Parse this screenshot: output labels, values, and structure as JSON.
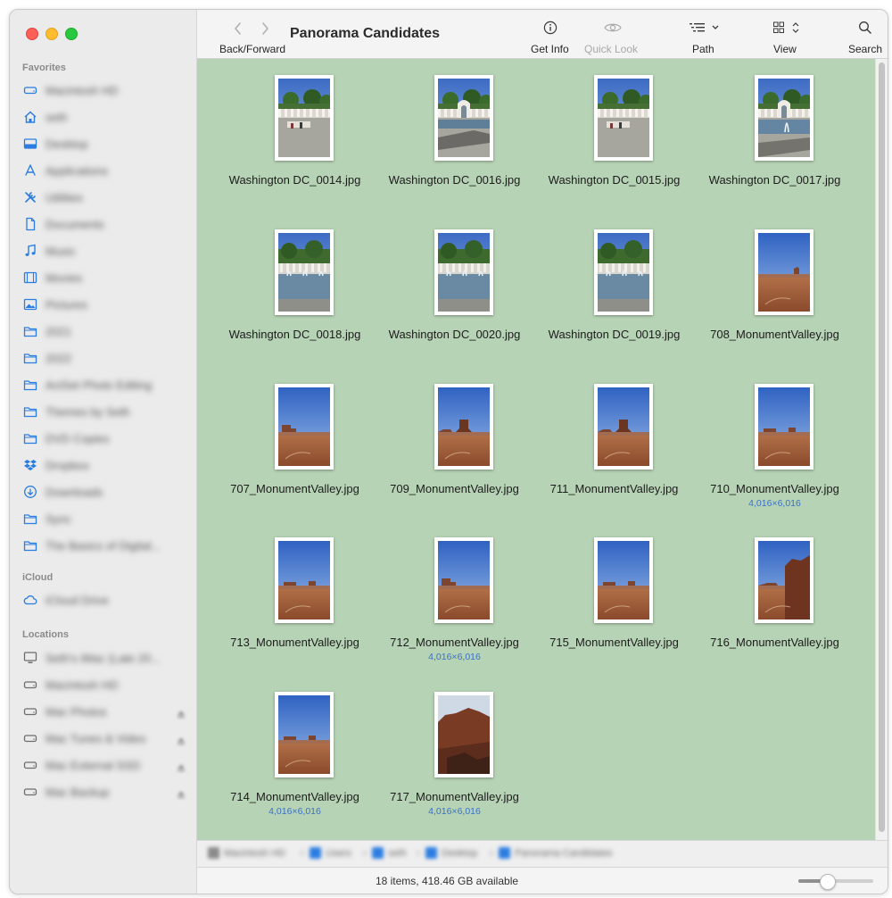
{
  "window": {
    "title": "Panorama Candidates"
  },
  "toolbar": {
    "back_forward_label": "Back/Forward",
    "get_info_label": "Get Info",
    "quick_look_label": "Quick Look",
    "path_label": "Path",
    "view_label": "View",
    "search_label": "Search"
  },
  "sidebar": {
    "favorites_heading": "Favorites",
    "favorites": [
      {
        "label": "Macintosh HD",
        "icon": "drive-icon"
      },
      {
        "label": "seth",
        "icon": "home-icon"
      },
      {
        "label": "Desktop",
        "icon": "desktop-icon"
      },
      {
        "label": "Applications",
        "icon": "applications-icon"
      },
      {
        "label": "Utilities",
        "icon": "utilities-icon"
      },
      {
        "label": "Documents",
        "icon": "document-icon"
      },
      {
        "label": "Music",
        "icon": "music-icon"
      },
      {
        "label": "Movies",
        "icon": "movies-icon"
      },
      {
        "label": "Pictures",
        "icon": "pictures-icon"
      },
      {
        "label": "2021",
        "icon": "folder-icon"
      },
      {
        "label": "2022",
        "icon": "folder-icon"
      },
      {
        "label": "ActSet Photo Editing",
        "icon": "folder-icon"
      },
      {
        "label": "Themes by Seth",
        "icon": "folder-icon"
      },
      {
        "label": "DVD Copies",
        "icon": "folder-icon"
      },
      {
        "label": "Dropbox",
        "icon": "dropbox-icon"
      },
      {
        "label": "Downloads",
        "icon": "downloads-icon"
      },
      {
        "label": "Sync",
        "icon": "folder-icon"
      },
      {
        "label": "The Basics of Digital...",
        "icon": "folder-icon"
      }
    ],
    "icloud_heading": "iCloud",
    "icloud": [
      {
        "label": "iCloud Drive",
        "icon": "cloud-icon"
      }
    ],
    "locations_heading": "Locations",
    "locations": [
      {
        "label": "Seth's iMac (Late 20...",
        "icon": "computer-icon",
        "eject": false
      },
      {
        "label": "Macintosh HD",
        "icon": "drive-icon",
        "eject": false
      },
      {
        "label": "Mac Photos",
        "icon": "drive-icon",
        "eject": true
      },
      {
        "label": "Mac Tunes & Video",
        "icon": "drive-icon",
        "eject": true
      },
      {
        "label": "Mac External SSD",
        "icon": "drive-icon",
        "eject": true
      },
      {
        "label": "Mac Backup",
        "icon": "drive-icon",
        "eject": true
      }
    ]
  },
  "files": [
    {
      "name": "Washington DC_0014.jpg",
      "dims": "",
      "scene": "dc-a"
    },
    {
      "name": "Washington DC_0016.jpg",
      "dims": "",
      "scene": "dc-b"
    },
    {
      "name": "Washington DC_0015.jpg",
      "dims": "",
      "scene": "dc-a"
    },
    {
      "name": "Washington DC_0017.jpg",
      "dims": "",
      "scene": "dc-c"
    },
    {
      "name": "Washington DC_0018.jpg",
      "dims": "",
      "scene": "dc-f"
    },
    {
      "name": "Washington DC_0020.jpg",
      "dims": "",
      "scene": "dc-f"
    },
    {
      "name": "Washington DC_0019.jpg",
      "dims": "",
      "scene": "dc-f"
    },
    {
      "name": "708_MonumentValley.jpg",
      "dims": "",
      "scene": "mv-plain"
    },
    {
      "name": "707_MonumentValley.jpg",
      "dims": "",
      "scene": "mv-left"
    },
    {
      "name": "709_MonumentValley.jpg",
      "dims": "",
      "scene": "mv-butte"
    },
    {
      "name": "711_MonumentValley.jpg",
      "dims": "",
      "scene": "mv-butte"
    },
    {
      "name": "710_MonumentValley.jpg",
      "dims": "4,016×6,016",
      "scene": "mv-far"
    },
    {
      "name": "713_MonumentValley.jpg",
      "dims": "",
      "scene": "mv-far"
    },
    {
      "name": "712_MonumentValley.jpg",
      "dims": "4,016×6,016",
      "scene": "mv-left"
    },
    {
      "name": "715_MonumentValley.jpg",
      "dims": "",
      "scene": "mv-far"
    },
    {
      "name": "716_MonumentValley.jpg",
      "dims": "",
      "scene": "mv-cliff"
    },
    {
      "name": "714_MonumentValley.jpg",
      "dims": "4,016×6,016",
      "scene": "mv-far"
    },
    {
      "name": "717_MonumentValley.jpg",
      "dims": "4,016×6,016",
      "scene": "mv-rock"
    }
  ],
  "pathbar": {
    "crumbs": [
      "Macintosh HD",
      "Users",
      "seth",
      "Desktop",
      "Panorama Candidates"
    ]
  },
  "status": {
    "text": "18 items, 418.46 GB available",
    "icon_size_level": 0.38
  },
  "colors": {
    "content_background": "#b7d3b5",
    "sidebar_icon": "#2b7de1",
    "dimension_text": "#3a70c7"
  }
}
